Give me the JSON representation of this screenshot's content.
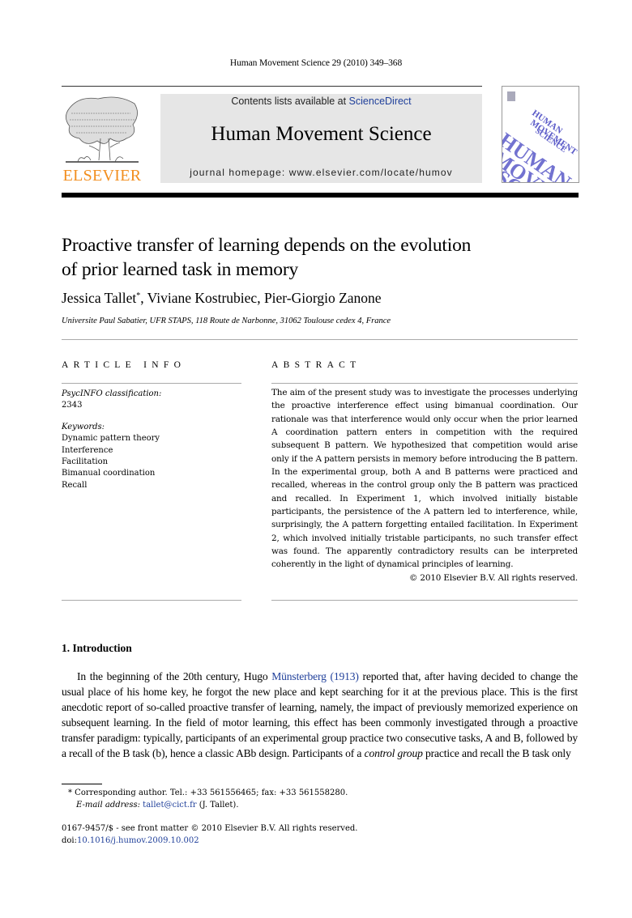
{
  "header": {
    "journal_citation": "Human Movement Science 29 (2010) 349–368",
    "publisher_logo_text": "ELSEVIER",
    "contents_prefix": "Contents lists available at ",
    "contents_link": "ScienceDirect",
    "journal_name": "Human Movement Science",
    "homepage": "journal homepage: www.elsevier.com/locate/humov",
    "cover_title_lines": [
      "HUMAN",
      "MOVEMENT",
      "SCIENCE"
    ],
    "colors": {
      "elsevier_orange": "#f28e1e",
      "link_blue": "#1f3f9a",
      "cover_purple": "#5a5ac8",
      "masthead_gray": "#e6e6e6"
    }
  },
  "article": {
    "title_line1": "Proactive transfer of learning depends on the evolution",
    "title_line2": "of prior learned task in memory",
    "author1": "Jessica Tallet",
    "author1_mark": "*",
    "authors_rest": ", Viviane Kostrubiec, Pier-Giorgio Zanone",
    "affiliation": "Universite Paul Sabatier, UFR STAPS, 118 Route de Narbonne, 31062 Toulouse cedex 4, France"
  },
  "article_info": {
    "heading": "ARTICLE INFO",
    "classification_label": "PsycINFO classification:",
    "classification_value": "2343",
    "keywords_label": "Keywords:",
    "keywords": [
      "Dynamic pattern theory",
      "Interference",
      "Facilitation",
      "Bimanual coordination",
      "Recall"
    ]
  },
  "abstract": {
    "heading": "ABSTRACT",
    "text": "The aim of the present study was to investigate the processes underlying the proactive interference effect using bimanual coordination. Our rationale was that interference would only occur when the prior learned A coordination pattern enters in competition with the required subsequent B pattern. We hypothesized that competition would arise only if the A pattern persists in memory before introducing the B pattern. In the experimental group, both A and B patterns were practiced and recalled, whereas in the control group only the B pattern was practiced and recalled. In Experiment 1, which involved initially bistable participants, the persistence of the A pattern led to interference, while, surprisingly, the A pattern forgetting entailed facilitation. In Experiment 2, which involved initially tristable participants, no such transfer effect was found. The apparently contradictory results can be interpreted coherently in the light of dynamical principles of learning.",
    "copyright": "© 2010 Elsevier B.V. All rights reserved."
  },
  "introduction": {
    "heading": "1. Introduction",
    "p1_before_link": "In the beginning of the 20th century, Hugo ",
    "p1_link": "Münsterberg (1913)",
    "p1_after_link": " reported that, after having decided to change the usual place of his home key, he forgot the new place and kept searching for it at the previous place. This is the first anecdotic report of so-called proactive transfer of learning, namely, the impact of previously memorized experience on subsequent learning. In the field of motor learning, this effect has been commonly investigated through a proactive transfer paradigm: typically, participants of an experimental group practice two consecutive tasks, A and B, followed by a recall of the B task (b), hence a classic ABb design. Participants of a ",
    "p1_italic": "control group",
    "p1_end": " practice and recall the B task only"
  },
  "footnote": {
    "mark": "*",
    "text": " Corresponding author. Tel.: +33 561556465; fax: +33 561558280.",
    "email_label": "E-mail address:",
    "email": "tallet@cict.fr",
    "email_suffix": " (J. Tallet)."
  },
  "bottom": {
    "issn_line": "0167-9457/$ - see front matter © 2010 Elsevier B.V. All rights reserved.",
    "doi_prefix": "doi:",
    "doi": "10.1016/j.humov.2009.10.002"
  }
}
